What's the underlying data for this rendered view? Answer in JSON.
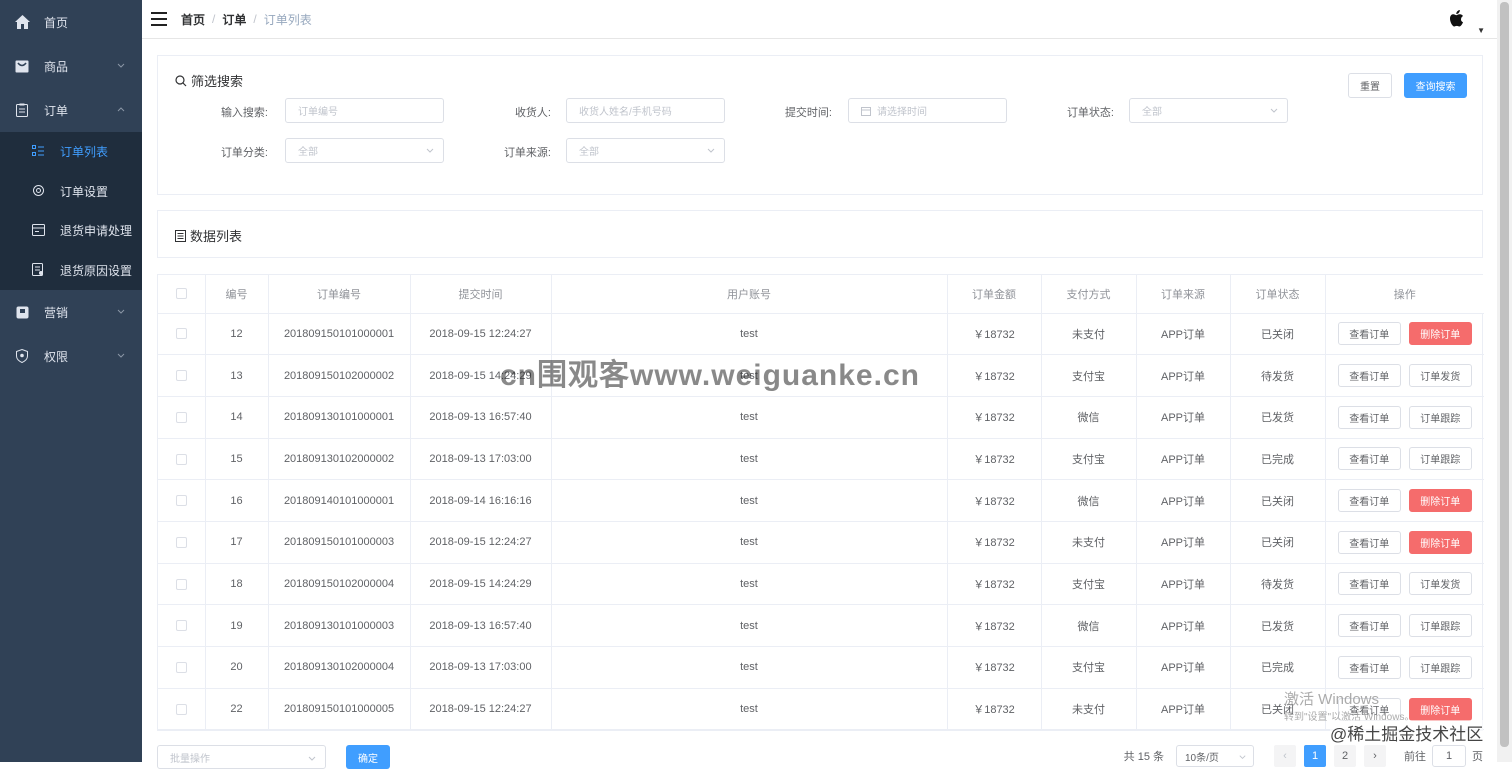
{
  "sidebar": {
    "items": [
      {
        "label": "首页",
        "icon": "home-icon"
      },
      {
        "label": "商品",
        "icon": "product-icon"
      },
      {
        "label": "订单",
        "icon": "order-icon"
      },
      {
        "label": "营销",
        "icon": "marketing-icon"
      },
      {
        "label": "权限",
        "icon": "permission-icon"
      }
    ],
    "submenu": [
      {
        "label": "订单列表",
        "icon": "list-icon",
        "active": true
      },
      {
        "label": "订单设置",
        "icon": "settings-icon"
      },
      {
        "label": "退货申请处理",
        "icon": "return-icon"
      },
      {
        "label": "退货原因设置",
        "icon": "reason-icon"
      }
    ]
  },
  "navbar": {
    "breadcrumb": [
      "首页",
      "订单",
      "订单列表"
    ],
    "avatar_icon": "apple-icon"
  },
  "filter": {
    "title": "筛选搜索",
    "reset_label": "重置",
    "search_label": "查询搜索",
    "fields": {
      "keyword": {
        "label": "输入搜索:",
        "placeholder": "订单编号"
      },
      "receiver": {
        "label": "收货人:",
        "placeholder": "收货人姓名/手机号码"
      },
      "time": {
        "label": "提交时间:",
        "placeholder": "请选择时间"
      },
      "status": {
        "label": "订单状态:",
        "placeholder": "全部"
      },
      "category": {
        "label": "订单分类:",
        "placeholder": "全部"
      },
      "source": {
        "label": "订单来源:",
        "placeholder": "全部"
      }
    }
  },
  "list": {
    "title": "数据列表"
  },
  "table": {
    "headers": [
      "编号",
      "订单编号",
      "提交时间",
      "用户账号",
      "订单金额",
      "支付方式",
      "订单来源",
      "订单状态",
      "操作"
    ],
    "rows": [
      {
        "id": "12",
        "sn": "201809150101000001",
        "time": "2018-09-15 12:24:27",
        "user": "test",
        "amount": "￥18732",
        "pay": "未支付",
        "source": "APP订单",
        "status": "已关闭",
        "op1": "查看订单",
        "op2": "删除订单",
        "op2_danger": true
      },
      {
        "id": "13",
        "sn": "201809150102000002",
        "time": "2018-09-15 14:24:29",
        "user": "test",
        "amount": "￥18732",
        "pay": "支付宝",
        "source": "APP订单",
        "status": "待发货",
        "op1": "查看订单",
        "op2": "订单发货",
        "op2_danger": false
      },
      {
        "id": "14",
        "sn": "201809130101000001",
        "time": "2018-09-13 16:57:40",
        "user": "test",
        "amount": "￥18732",
        "pay": "微信",
        "source": "APP订单",
        "status": "已发货",
        "op1": "查看订单",
        "op2": "订单跟踪",
        "op2_danger": false
      },
      {
        "id": "15",
        "sn": "201809130102000002",
        "time": "2018-09-13 17:03:00",
        "user": "test",
        "amount": "￥18732",
        "pay": "支付宝",
        "source": "APP订单",
        "status": "已完成",
        "op1": "查看订单",
        "op2": "订单跟踪",
        "op2_danger": false
      },
      {
        "id": "16",
        "sn": "201809140101000001",
        "time": "2018-09-14 16:16:16",
        "user": "test",
        "amount": "￥18732",
        "pay": "微信",
        "source": "APP订单",
        "status": "已关闭",
        "op1": "查看订单",
        "op2": "删除订单",
        "op2_danger": true
      },
      {
        "id": "17",
        "sn": "201809150101000003",
        "time": "2018-09-15 12:24:27",
        "user": "test",
        "amount": "￥18732",
        "pay": "未支付",
        "source": "APP订单",
        "status": "已关闭",
        "op1": "查看订单",
        "op2": "删除订单",
        "op2_danger": true
      },
      {
        "id": "18",
        "sn": "201809150102000004",
        "time": "2018-09-15 14:24:29",
        "user": "test",
        "amount": "￥18732",
        "pay": "支付宝",
        "source": "APP订单",
        "status": "待发货",
        "op1": "查看订单",
        "op2": "订单发货",
        "op2_danger": false
      },
      {
        "id": "19",
        "sn": "201809130101000003",
        "time": "2018-09-13 16:57:40",
        "user": "test",
        "amount": "￥18732",
        "pay": "微信",
        "source": "APP订单",
        "status": "已发货",
        "op1": "查看订单",
        "op2": "订单跟踪",
        "op2_danger": false
      },
      {
        "id": "20",
        "sn": "201809130102000004",
        "time": "2018-09-13 17:03:00",
        "user": "test",
        "amount": "￥18732",
        "pay": "支付宝",
        "source": "APP订单",
        "status": "已完成",
        "op1": "查看订单",
        "op2": "订单跟踪",
        "op2_danger": false
      },
      {
        "id": "22",
        "sn": "201809150101000005",
        "time": "2018-09-15 12:24:27",
        "user": "test",
        "amount": "￥18732",
        "pay": "未支付",
        "source": "APP订单",
        "status": "已关闭",
        "op1": "查看订单",
        "op2": "删除订单",
        "op2_danger": true
      }
    ]
  },
  "bottom": {
    "batch_placeholder": "批量操作",
    "confirm_label": "确定",
    "total_text": "共 15 条",
    "page_size": "10条/页",
    "pages": [
      "1",
      "2"
    ],
    "current_page": "1",
    "goto_prefix": "前往",
    "goto_value": "1",
    "goto_suffix": "页"
  },
  "overlays": {
    "watermark": "cn围观客www.weiguanke.cn",
    "windows_activate": "激活 Windows",
    "windows_hint": "转到\"设置\"以激活 Windows。",
    "juejin": "@稀土掘金技术社区"
  },
  "colors": {
    "sidebar_bg": "#304156",
    "primary": "#409eff",
    "danger": "#f56c6c"
  }
}
